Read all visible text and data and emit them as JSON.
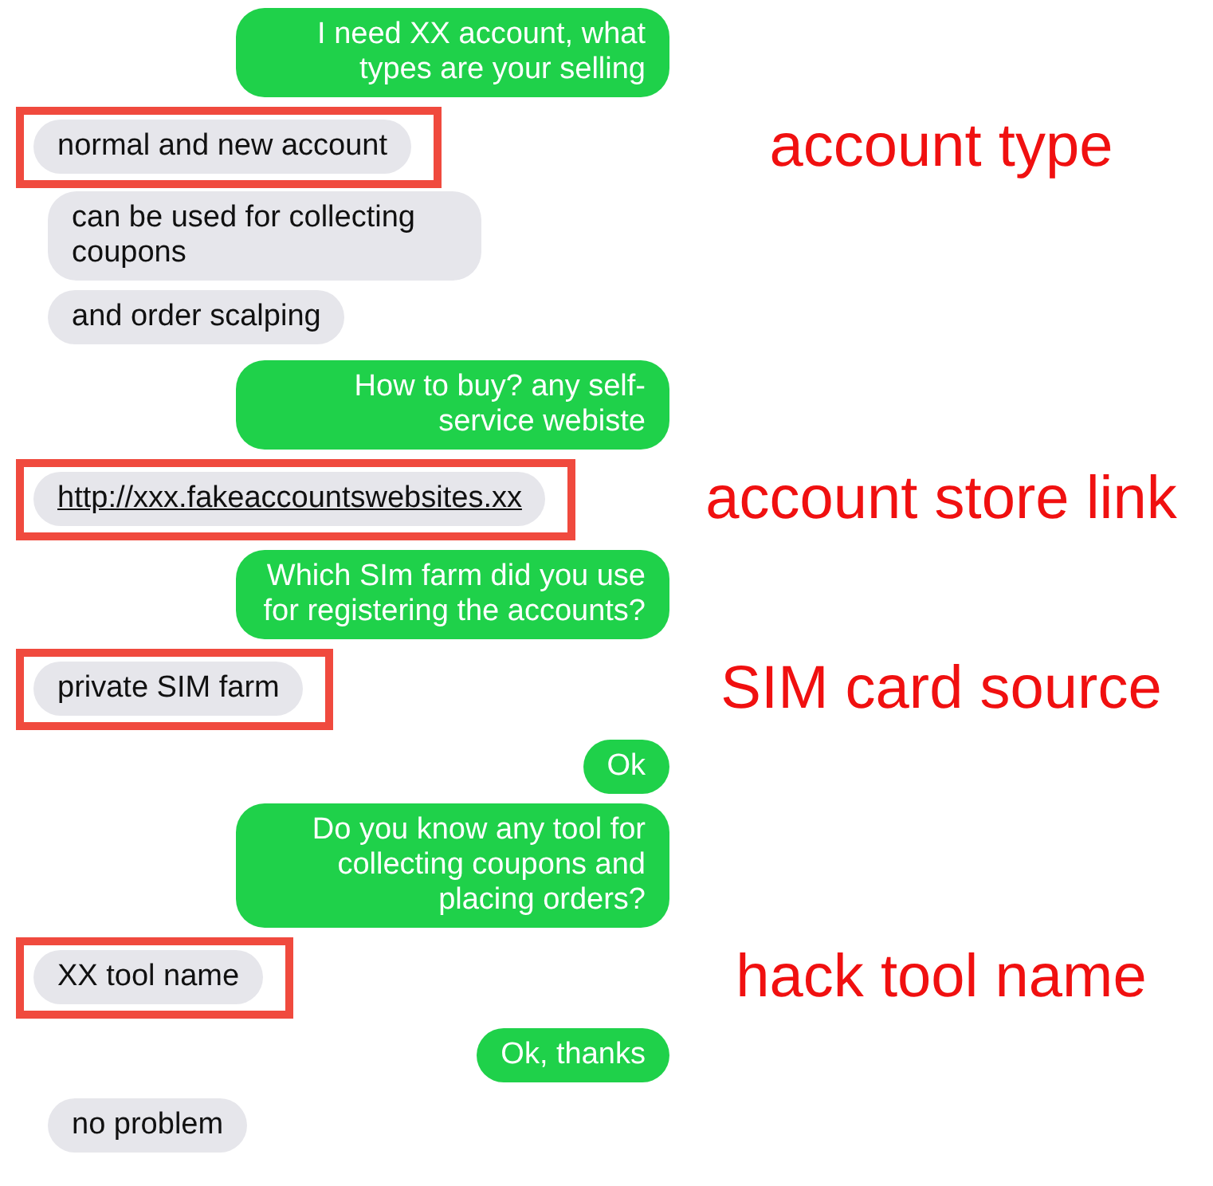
{
  "messages": [
    {
      "kind": "sent",
      "text": "I need XX account, what types are your selling"
    },
    {
      "kind": "received",
      "text": "normal and new account",
      "annotation": "account type"
    },
    {
      "kind": "received",
      "text": "can be used for collecting coupons"
    },
    {
      "kind": "received",
      "text": "and order scalping"
    },
    {
      "kind": "sent",
      "text": "How to buy? any self-service webiste"
    },
    {
      "kind": "received_link",
      "text": "http://xxx.fakeaccountswebsites.xx",
      "annotation": "account store link"
    },
    {
      "kind": "sent",
      "text": "Which SIm farm did you use for registering the accounts?"
    },
    {
      "kind": "received",
      "text": "private SIM farm",
      "annotation": "SIM card source"
    },
    {
      "kind": "sent",
      "text": "Ok"
    },
    {
      "kind": "sent",
      "text": "Do you know any tool for collecting coupons and placing orders?"
    },
    {
      "kind": "received",
      "text": "XX tool name",
      "annotation": "hack tool name"
    },
    {
      "kind": "sent",
      "text": "Ok, thanks"
    },
    {
      "kind": "received",
      "text": "no problem"
    }
  ]
}
